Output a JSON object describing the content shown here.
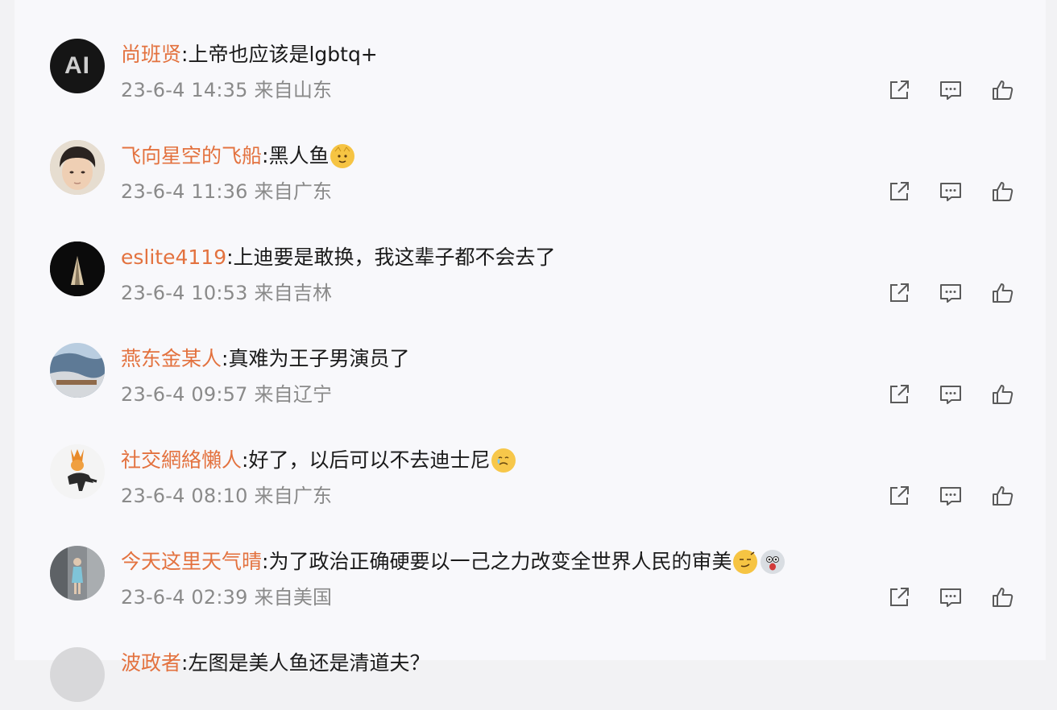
{
  "comments": [
    {
      "username": "尚班贤",
      "separator": ":",
      "text": "上帝也应该是lgbtq+",
      "date": "23-6-4 14:35",
      "location": "来自山东"
    },
    {
      "username": "飞向星空的飞船",
      "separator": ":",
      "text": "黑人鱼",
      "date": "23-6-4 11:36",
      "location": "来自广东"
    },
    {
      "username": "eslite4119",
      "separator": ":",
      "text": "上迪要是敢换，我这辈子都不会去了",
      "date": "23-6-4 10:53",
      "location": "来自吉林"
    },
    {
      "username": "燕东金某人",
      "separator": ":",
      "text": "真难为王子男演员了",
      "date": "23-6-4 09:57",
      "location": "来自辽宁"
    },
    {
      "username": "社交網絡懶人",
      "separator": ":",
      "text": "好了，以后可以不去迪士尼",
      "date": "23-6-4 08:10",
      "location": "来自广东"
    },
    {
      "username": "今天这里天气晴",
      "separator": ":",
      "text": "为了政治正确硬要以一己之力改变全世界人民的审美",
      "date": "23-6-4 02:39",
      "location": "来自美国"
    },
    {
      "username": "波政者",
      "separator": ":",
      "text": "左图是美人鱼还是清道夫？",
      "date": "",
      "location": ""
    }
  ],
  "avatar_text": "AI",
  "icons": {
    "share": "share-icon",
    "comment": "comment-icon",
    "like": "like-icon"
  },
  "colors": {
    "username": "#e3723f",
    "meta": "#8a8a8a",
    "icon": "#5a5a5a"
  }
}
